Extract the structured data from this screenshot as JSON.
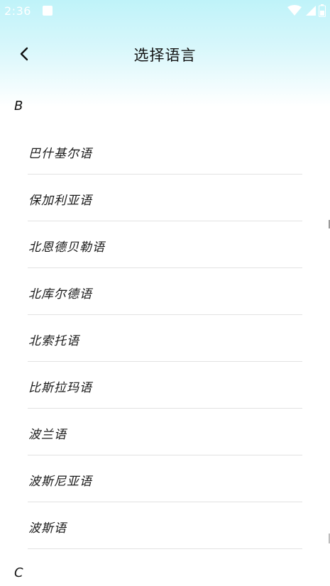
{
  "status_bar": {
    "time": "2:36"
  },
  "header": {
    "title": "选择语言"
  },
  "sections": [
    {
      "letter": "B",
      "items": [
        {
          "label": "巴什基尔语"
        },
        {
          "label": "保加利亚语"
        },
        {
          "label": "北恩德贝勒语"
        },
        {
          "label": "北库尔德语"
        },
        {
          "label": "北索托语"
        },
        {
          "label": "比斯拉玛语"
        },
        {
          "label": "波兰语"
        },
        {
          "label": "波斯尼亚语"
        },
        {
          "label": "波斯语"
        }
      ]
    },
    {
      "letter": "C",
      "items": []
    }
  ],
  "icons": {
    "back": "chevron-left-icon",
    "wifi": "wifi-icon",
    "signal": "signal-icon",
    "battery": "battery-icon",
    "notification": "notification-icon"
  },
  "colors": {
    "header_gradient_top": "#bff3f9",
    "divider": "#e2e2e2",
    "text": "#111111"
  }
}
